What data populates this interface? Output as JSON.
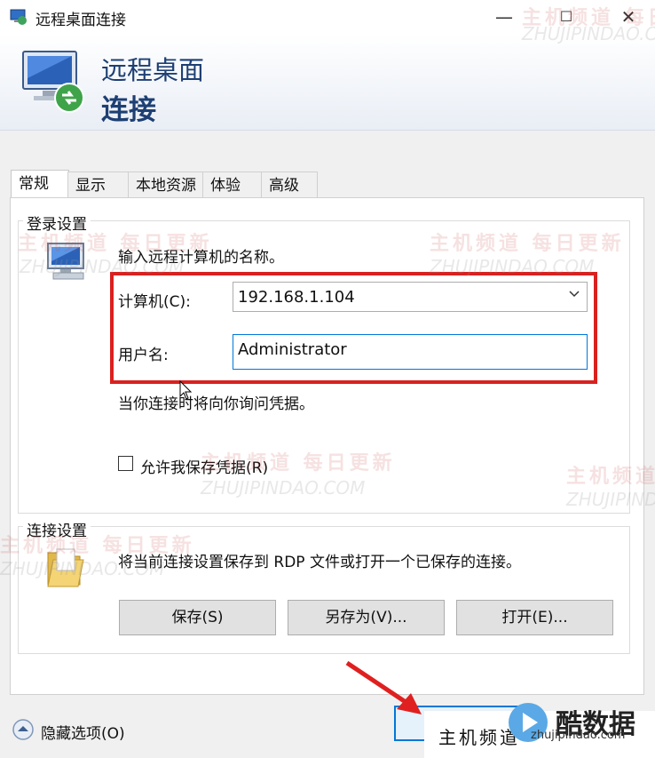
{
  "window": {
    "title": "远程桌面连接",
    "controls": {
      "minimize": "—",
      "maximize": "☐",
      "close": "✕"
    }
  },
  "header": {
    "line1": "远程桌面",
    "line2": "连接"
  },
  "tabs": [
    {
      "label": "常规",
      "active": true
    },
    {
      "label": "显示",
      "active": false
    },
    {
      "label": "本地资源",
      "active": false
    },
    {
      "label": "体验",
      "active": false
    },
    {
      "label": "高级",
      "active": false
    }
  ],
  "login": {
    "group_title": "登录设置",
    "instruction": "输入远程计算机的名称。",
    "computer_label": "计算机(C):",
    "computer_value": "192.168.1.104",
    "username_label": "用户名:",
    "username_value": "Administrator",
    "credential_note": "当你连接时将向你询问凭据。",
    "save_cred_label": "允许我保存凭据(R)",
    "save_cred_checked": false
  },
  "connection": {
    "group_title": "连接设置",
    "description": "将当前连接设置保存到 RDP 文件或打开一个已保存的连接。",
    "save_button": "保存(S)",
    "save_as_button": "另存为(V)...",
    "open_button": "打开(E)..."
  },
  "footer": {
    "hide_options_label": "隐藏选项(O)"
  },
  "watermark": {
    "cn": "主机频道 每日更新",
    "cn_short": "主机频道",
    "url": "ZHUJIPINDAO.COM",
    "brand_name": "主机频道",
    "brand_logo_text": "酷数据",
    "brand_url": "zhujipindao.com"
  },
  "colors": {
    "accent": "#0078d7",
    "highlight_box": "#d9211f",
    "header_text": "#1d3f73",
    "arrow": "#e02020"
  }
}
